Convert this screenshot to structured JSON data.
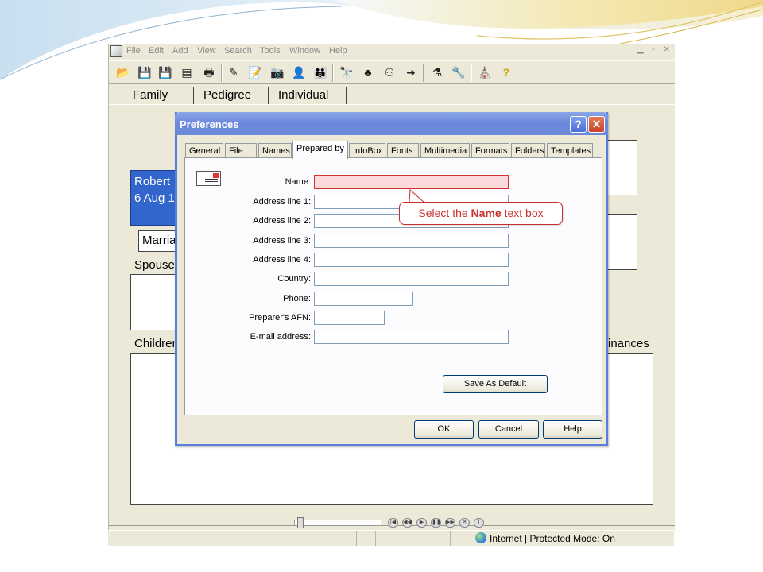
{
  "menu": [
    "File",
    "Edit",
    "Add",
    "View",
    "Search",
    "Tools",
    "Window",
    "Help"
  ],
  "view_tabs": [
    "Family",
    "Pedigree",
    "Individual"
  ],
  "family_view": {
    "person_name": "Robert",
    "person_date": "6 Aug 1",
    "marriage_field": "Marria",
    "spouse_label": "Spouse",
    "children_label": "Children",
    "ordinances_label": "inances"
  },
  "dialog": {
    "title": "Preferences",
    "help_glyph": "?",
    "close_glyph": "✕",
    "tabs": [
      "General",
      "File",
      "Names",
      "Prepared by",
      "InfoBox",
      "Fonts",
      "Multimedia",
      "Formats",
      "Folders",
      "Templates"
    ],
    "active_tab": "Prepared by",
    "fields": [
      {
        "label": "Name:",
        "value": ""
      },
      {
        "label": "Address line 1:",
        "value": ""
      },
      {
        "label": "Address line 2:",
        "value": ""
      },
      {
        "label": "Address line 3:",
        "value": ""
      },
      {
        "label": "Address line 4:",
        "value": ""
      },
      {
        "label": "Country:",
        "value": ""
      },
      {
        "label": "Phone:",
        "value": ""
      },
      {
        "label": "Preparer's AFN:",
        "value": ""
      },
      {
        "label": "E-mail address:",
        "value": ""
      }
    ],
    "save_default": "Save As Default",
    "ok": "OK",
    "cancel": "Cancel",
    "help": "Help"
  },
  "callout": {
    "before": "Select the ",
    "bold": "Name",
    "after": " text box"
  },
  "status_bar": {
    "zone_text": "Internet | Protected Mode: On"
  },
  "colors": {
    "selected_person": "#3366cc",
    "highlight_field": "#fadada",
    "callout_red": "#c83030",
    "xp_title_blue": "#6a88dc"
  }
}
